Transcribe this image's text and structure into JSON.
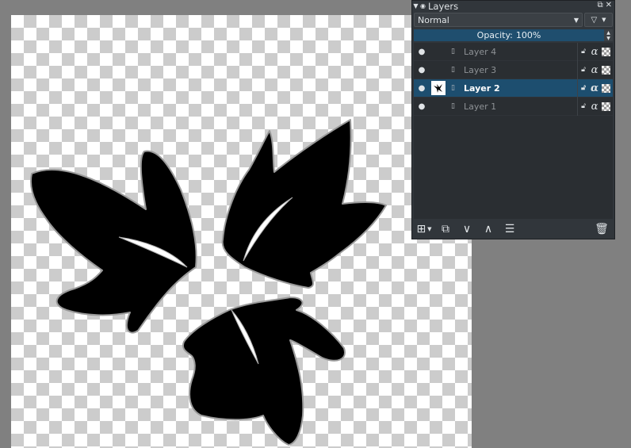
{
  "docker": {
    "title": "Layers",
    "blend_mode": "Normal",
    "opacity_label": "Opacity:",
    "opacity_value": "100%",
    "layers": [
      {
        "name": "Layer 4",
        "selected": false
      },
      {
        "name": "Layer 3",
        "selected": false
      },
      {
        "name": "Layer 2",
        "selected": true
      },
      {
        "name": "Layer 1",
        "selected": false
      }
    ]
  },
  "icons": {
    "visibility": "eye-icon",
    "lock": "lock-icon",
    "alpha": "α",
    "inherit_alpha": "checker-icon"
  },
  "colors": {
    "selection": "#1d4e6f",
    "docker_bg": "#31363b",
    "workspace_bg": "#808080",
    "artwork": "#000000"
  }
}
